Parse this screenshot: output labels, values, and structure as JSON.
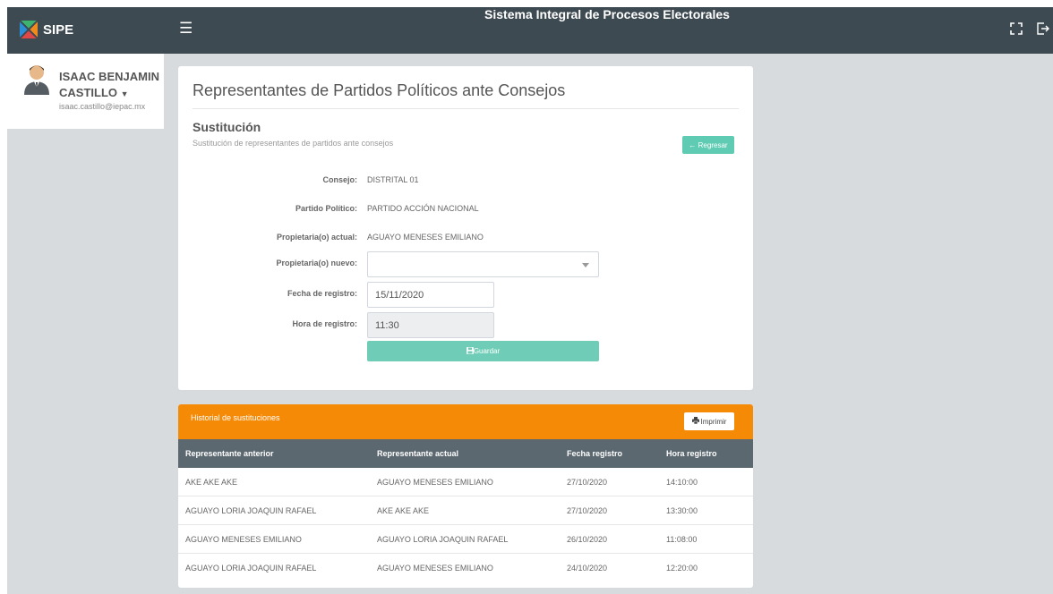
{
  "app": {
    "brand": "SIPE",
    "system_title": "Sistema Integral de Procesos Electorales"
  },
  "icons": {
    "menu": "hamburger-icon",
    "fullscreen": "expand-icon",
    "logout": "logout-icon",
    "back": "arrow-left-icon",
    "save": "floppy-disk-icon",
    "print": "printer-icon"
  },
  "user": {
    "name": "ISAAC BENJAMIN CASTILLO",
    "email": "isaac.castillo@iepac.mx"
  },
  "page": {
    "title": "Representantes de Partidos Políticos ante Consejos",
    "section_title": "Sustitución",
    "section_subtitle": "Sustitución de representantes de partidos ante consejos",
    "back_label": "Regresar"
  },
  "form": {
    "consejo_label": "Consejo:",
    "consejo_value": "DISTRITAL 01",
    "partido_label": "Partido Político:",
    "partido_value": "PARTIDO ACCIÓN NACIONAL",
    "actual_label": "Propietaria(o) actual:",
    "actual_value": "AGUAYO MENESES EMILIANO",
    "nuevo_label": "Propietaria(o) nuevo:",
    "nuevo_value": "",
    "fecha_label": "Fecha de registro:",
    "fecha_value": "15/11/2020",
    "hora_label": "Hora de registro:",
    "hora_value": "11:30",
    "save_label": "Guardar"
  },
  "history": {
    "title": "Historial de sustituciones",
    "print_label": "Imprimir",
    "columns": [
      "Representante anterior",
      "Representante actual",
      "Fecha registro",
      "Hora registro"
    ],
    "rows": [
      [
        "AKE AKE AKE",
        "AGUAYO MENESES EMILIANO",
        "27/10/2020",
        "14:10:00"
      ],
      [
        "AGUAYO LORIA JOAQUIN RAFAEL",
        "AKE AKE AKE",
        "27/10/2020",
        "13:30:00"
      ],
      [
        "AGUAYO MENESES EMILIANO",
        "AGUAYO LORIA JOAQUIN RAFAEL",
        "26/10/2020",
        "11:08:00"
      ],
      [
        "AGUAYO LORIA JOAQUIN RAFAEL",
        "AGUAYO MENESES EMILIANO",
        "24/10/2020",
        "12:20:00"
      ]
    ]
  },
  "colors": {
    "topbar": "#3e4a52",
    "accent_teal": "#5fcbb3",
    "history_header": "#f58a07",
    "table_header": "#5c6870",
    "page_bg": "#d7dbdd"
  }
}
